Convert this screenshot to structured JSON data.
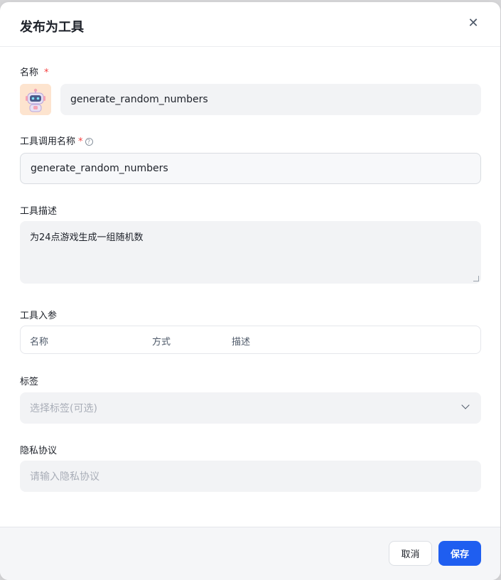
{
  "dialog": {
    "title": "发布为工具",
    "close_icon": "close-icon"
  },
  "name_field": {
    "label": "名称",
    "required_mark": "*",
    "avatar_icon": "robot-avatar-icon",
    "value": "generate_random_numbers"
  },
  "call_name_field": {
    "label": "工具调用名称",
    "required_mark": "*",
    "help_icon": "help-circle-icon",
    "help_glyph": "?",
    "value": "generate_random_numbers"
  },
  "description_field": {
    "label": "工具描述",
    "value": "为24点游戏生成一组随机数"
  },
  "params_field": {
    "label": "工具入参",
    "columns": [
      "名称",
      "方式",
      "描述"
    ]
  },
  "tags_field": {
    "label": "标签",
    "placeholder": "选择标签(可选)",
    "dropdown_icon": "chevron-down-icon"
  },
  "privacy_field": {
    "label": "隐私协议",
    "placeholder": "请输入隐私协议"
  },
  "footer": {
    "cancel_label": "取消",
    "save_label": "保存"
  },
  "colors": {
    "primary": "#1f5ef0",
    "required": "#f53f3f",
    "input_bg": "#f2f3f5",
    "avatar_bg": "#fde4cf"
  }
}
